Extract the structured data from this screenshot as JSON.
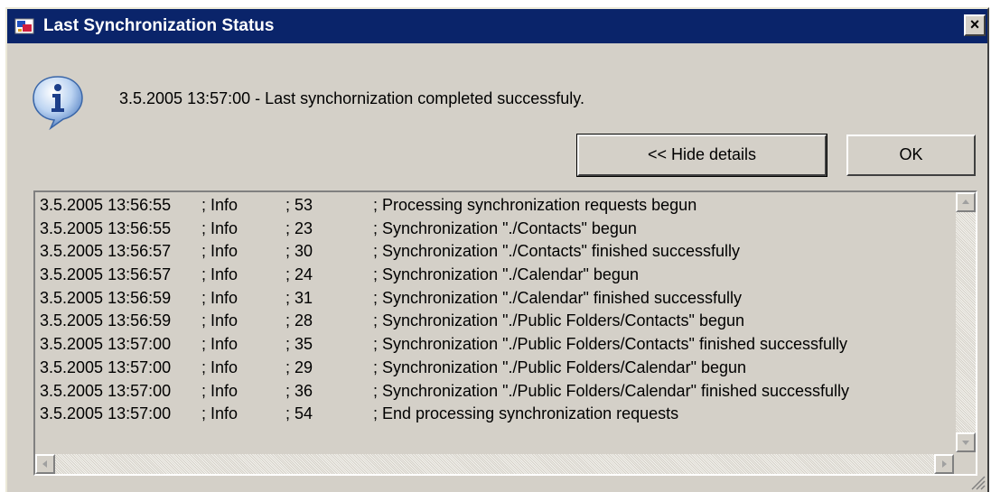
{
  "window": {
    "title": "Last Synchronization Status",
    "close_glyph": "×",
    "icon": "sync-app-icon"
  },
  "message": {
    "icon": "info-balloon-icon",
    "text": "3.5.2005 13:57:00 - Last synchornization completed successfuly."
  },
  "buttons": {
    "hide_details": "<< Hide details",
    "ok": "OK"
  },
  "log": {
    "rows": [
      {
        "date": "3.5.2005 13:56:55",
        "level": "; Info",
        "code": "; 53",
        "message": "; Processing synchronization requests begun"
      },
      {
        "date": "3.5.2005 13:56:55",
        "level": "; Info",
        "code": "; 23",
        "message": "; Synchronization \"./Contacts\" begun"
      },
      {
        "date": "3.5.2005 13:56:57",
        "level": "; Info",
        "code": "; 30",
        "message": "; Synchronization \"./Contacts\" finished successfully"
      },
      {
        "date": "3.5.2005 13:56:57",
        "level": "; Info",
        "code": "; 24",
        "message": "; Synchronization \"./Calendar\" begun"
      },
      {
        "date": "3.5.2005 13:56:59",
        "level": "; Info",
        "code": "; 31",
        "message": "; Synchronization \"./Calendar\" finished successfully"
      },
      {
        "date": "3.5.2005 13:56:59",
        "level": "; Info",
        "code": "; 28",
        "message": "; Synchronization \"./Public Folders/Contacts\" begun"
      },
      {
        "date": "3.5.2005 13:57:00",
        "level": "; Info",
        "code": "; 35",
        "message": "; Synchronization \"./Public Folders/Contacts\" finished successfully"
      },
      {
        "date": "3.5.2005 13:57:00",
        "level": "; Info",
        "code": "; 29",
        "message": "; Synchronization \"./Public Folders/Calendar\" begun"
      },
      {
        "date": "3.5.2005 13:57:00",
        "level": "; Info",
        "code": "; 36",
        "message": "; Synchronization \"./Public Folders/Calendar\" finished successfully"
      },
      {
        "date": "3.5.2005 13:57:00",
        "level": "; Info",
        "code": "; 54",
        "message": "; End processing synchronization requests"
      }
    ]
  },
  "colors": {
    "titlebar": "#0a246a",
    "face": "#d4d0c8"
  }
}
